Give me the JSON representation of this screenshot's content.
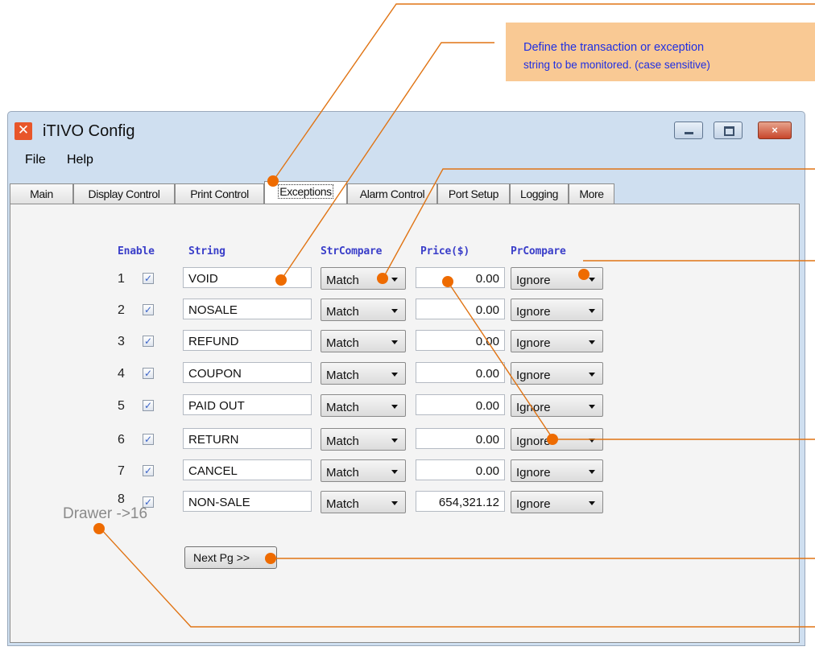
{
  "callout": {
    "line1": "Define the transaction or exception",
    "line2": "string to be monitored. (case sensitive)"
  },
  "window": {
    "title": "iTIVO Config",
    "close_glyph": "×",
    "app_icon_glyph": "✕"
  },
  "menu": [
    "File",
    "Help"
  ],
  "tabs": [
    "Main",
    "Display Control",
    "Print Control",
    "Exceptions",
    "Alarm Control",
    "Port Setup",
    "Logging",
    "More"
  ],
  "active_tab": "Exceptions",
  "headers": {
    "enable": "Enable",
    "string": "String",
    "strcompare": "StrCompare",
    "price": "Price($)",
    "prcompare": "PrCompare"
  },
  "checkmark": "✓",
  "dropdown_arrow": "▼",
  "rows": [
    {
      "index": "1",
      "enabled": true,
      "string": "VOID",
      "strcompare": "Match",
      "price": "0.00",
      "prcompare": "Ignore"
    },
    {
      "index": "2",
      "enabled": true,
      "string": "NOSALE",
      "strcompare": "Match",
      "price": "0.00",
      "prcompare": "Ignore"
    },
    {
      "index": "3",
      "enabled": true,
      "string": "REFUND",
      "strcompare": "Match",
      "price": "0.00",
      "prcompare": "Ignore"
    },
    {
      "index": "4",
      "enabled": true,
      "string": "COUPON",
      "strcompare": "Match",
      "price": "0.00",
      "prcompare": "Ignore"
    },
    {
      "index": "5",
      "enabled": true,
      "string": "PAID OUT",
      "strcompare": "Match",
      "price": "0.00",
      "prcompare": "Ignore"
    },
    {
      "index": "6",
      "enabled": true,
      "string": "RETURN",
      "strcompare": "Match",
      "price": "0.00",
      "prcompare": "Ignore"
    },
    {
      "index": "7",
      "enabled": true,
      "string": "CANCEL",
      "strcompare": "Match",
      "price": "0.00",
      "prcompare": "Ignore"
    },
    {
      "index": "8",
      "enabled": true,
      "string": "NON-SALE",
      "strcompare": "Match",
      "price": "654,321.12",
      "prcompare": "Ignore"
    }
  ],
  "drawer_label": "Drawer ->16",
  "next_button": "Next Pg >>",
  "colors": {
    "callout_bg": "#f9c994",
    "callout_text": "#1f2fe3",
    "annotation_line": "#e07414",
    "marker_dot": "#ee6b00",
    "header_text": "#3a3ec9",
    "window_frame": "#cfdff0",
    "close_button": "#c8462b"
  }
}
